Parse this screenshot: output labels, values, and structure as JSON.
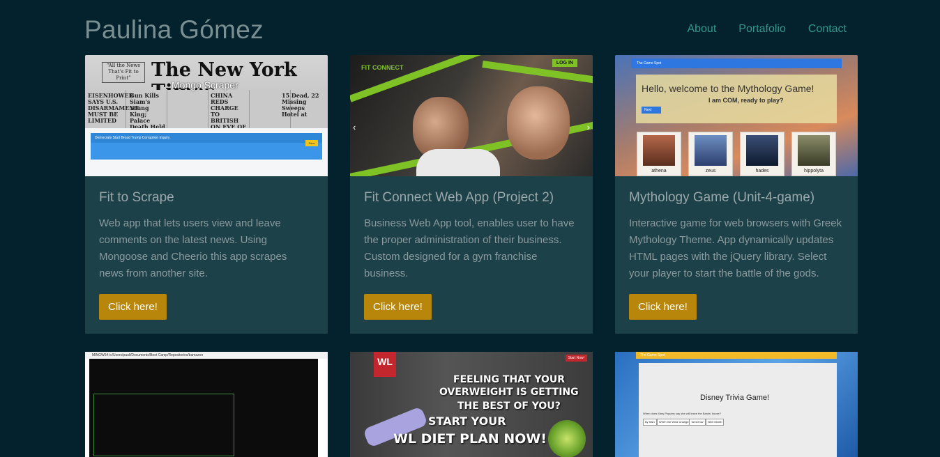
{
  "header": {
    "brand": "Paulina Gómez",
    "nav": [
      "About",
      "Portafolio",
      "Contact"
    ]
  },
  "projects": [
    {
      "title": "Fit to Scrape",
      "description": "Web app that lets users view and leave comments on the latest news. Using Mongoose and Cheerio this app scrapes news from another site.",
      "button": "Click here!",
      "thumb": {
        "overlay": "Mongo Scraper",
        "masthead": "The New York Times.",
        "alert_title": "Democrats Start Broad Trump Corruption Inquiry"
      }
    },
    {
      "title": "Fit Connect Web App (Project 2)",
      "description": "Business Web App tool, enables user to have the proper administration of their business. Custom designed for a gym franchise business.",
      "button": "Click here!",
      "thumb": {
        "logo": "FIT CONNECT",
        "login": "LOG IN"
      }
    },
    {
      "title": "Mythology Game (Unit-4-game)",
      "description": "Interactive game for web browsers with Greek Mythology Theme. App dynamically updates HTML pages with the jQuery library. Select your player to start the battle of the gods.",
      "button": "Click here!",
      "thumb": {
        "navbar": "The Game Spot",
        "welcome": "Hello, welcome to the Mythology Game!",
        "subtitle": "I am COM, ready to play?",
        "characters": [
          "athena",
          "zeus",
          "hades",
          "hippolyta"
        ]
      }
    }
  ],
  "bottom_thumbs": {
    "terminal_title": "MINGW64:/c/Users/pauli/Documents/Boot Camp/Repositories/bamazon",
    "diet_badge": "WL",
    "diet_start": "Start Now!",
    "diet_lines": [
      "FEELING THAT YOUR",
      "OVERWEIGHT IS GETTING",
      "THE BEST OF YOU?",
      "START YOUR",
      "WL DIET PLAN NOW!"
    ],
    "trivia_navbar": "The Game Spot",
    "trivia_title": "Disney Trivia Game!",
    "trivia_question": "When does Mary Poppins say she will leave the Banks' house?",
    "trivia_answers": [
      "By train",
      "When the Wind Changes",
      "Tomorrow",
      "Next Month"
    ]
  },
  "colors": {
    "background": "#04222d",
    "card": "#1d4149",
    "button": "#b8860b",
    "nav_link": "#2f9a8d"
  }
}
